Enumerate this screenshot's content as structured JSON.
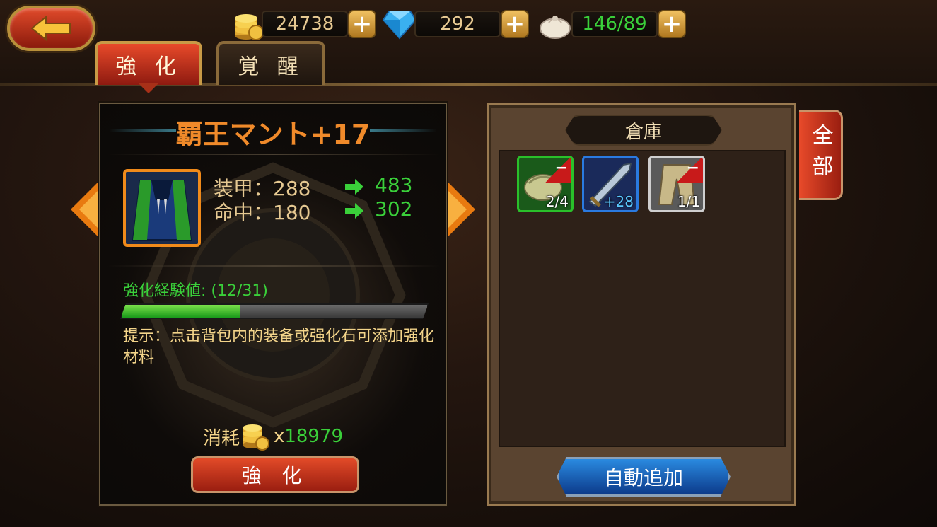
{
  "header": {
    "gold": "24738",
    "gems": "292",
    "stamina": "146/89"
  },
  "tabs": {
    "enhance": "強 化",
    "awaken": "覚 醒"
  },
  "item": {
    "name": "覇王マント+17",
    "stats": [
      {
        "label": "装甲：288",
        "new": "483"
      },
      {
        "label": "命中：180",
        "new": "302"
      }
    ],
    "exp_label": "強化経験値: (12/31)",
    "exp_current": 12,
    "exp_max": 31,
    "hint": "提示：点击背包内的装备或强化石可添加强化材料",
    "cost_label": "消耗",
    "cost_prefix": "x",
    "cost_value": "18979",
    "enhance_button": "強 化"
  },
  "storage": {
    "title": "倉庫",
    "filter_tab": "全部",
    "auto_button": "自動追加",
    "slots": [
      {
        "icon": "glove-icon",
        "count": "2/4",
        "frame": "#2ac02a"
      },
      {
        "icon": "sword-icon",
        "level": "+28",
        "frame": "#2a7ae0"
      },
      {
        "icon": "pants-icon",
        "count": "1/1",
        "frame": "#cfcfcf"
      }
    ]
  },
  "colors": {
    "accent_orange": "#f08a2a",
    "green": "#3ad03a",
    "red_button": "#c82a18",
    "blue_button": "#1a5ab8"
  }
}
